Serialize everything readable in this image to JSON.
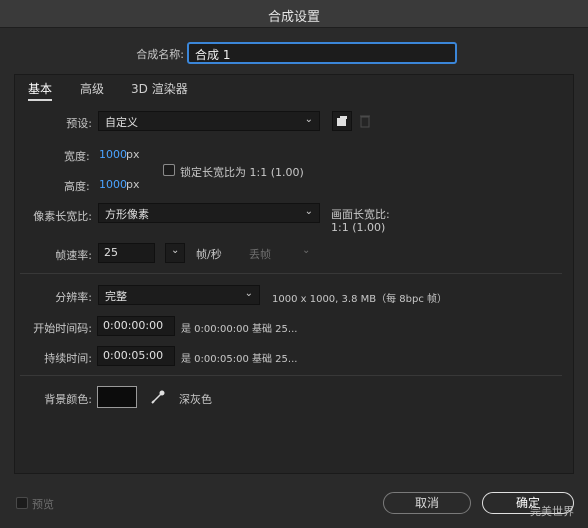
{
  "window": {
    "title": "合成设置"
  },
  "comp_name": {
    "label": "合成名称:",
    "value": "合成 1"
  },
  "tabs": [
    {
      "label": "基本",
      "active": true
    },
    {
      "label": "高级",
      "active": false
    },
    {
      "label": "3D 渲染器",
      "active": false
    }
  ],
  "preset": {
    "label": "预设:",
    "value": "自定义"
  },
  "width": {
    "label": "宽度:",
    "value": "1000",
    "unit": "px"
  },
  "height": {
    "label": "高度:",
    "value": "1000",
    "unit": "px"
  },
  "lock_aspect": {
    "label": "锁定长宽比为 1:1 (1.00)",
    "checked": false
  },
  "pixel_aspect": {
    "label": "像素长宽比:",
    "value": "方形像素"
  },
  "frame_aspect": {
    "label": "画面长宽比:",
    "value": "1:1 (1.00)"
  },
  "frame_rate": {
    "label": "帧速率:",
    "value": "25",
    "unit": "帧/秒",
    "drop_frame": "丢帧"
  },
  "resolution": {
    "label": "分辨率:",
    "value": "完整",
    "info": "1000 x 1000, 3.8 MB（每 8bpc 帧）"
  },
  "start_timecode": {
    "label": "开始时间码:",
    "value": "0:00:00:00",
    "info": "是 0:00:00:00  基础 25..."
  },
  "duration": {
    "label": "持续时间:",
    "value": "0:00:05:00",
    "info": "是 0:00:05:00  基础 25..."
  },
  "background": {
    "label": "背景颜色:",
    "color_name": "深灰色",
    "color": "#0c0c0c"
  },
  "footer": {
    "preview_label": "预览",
    "cancel_label": "取消",
    "ok_label": "确定",
    "watermark": "完美世界"
  },
  "colors": {
    "accent": "#4aa3ff",
    "focus": "#3b86d8"
  }
}
